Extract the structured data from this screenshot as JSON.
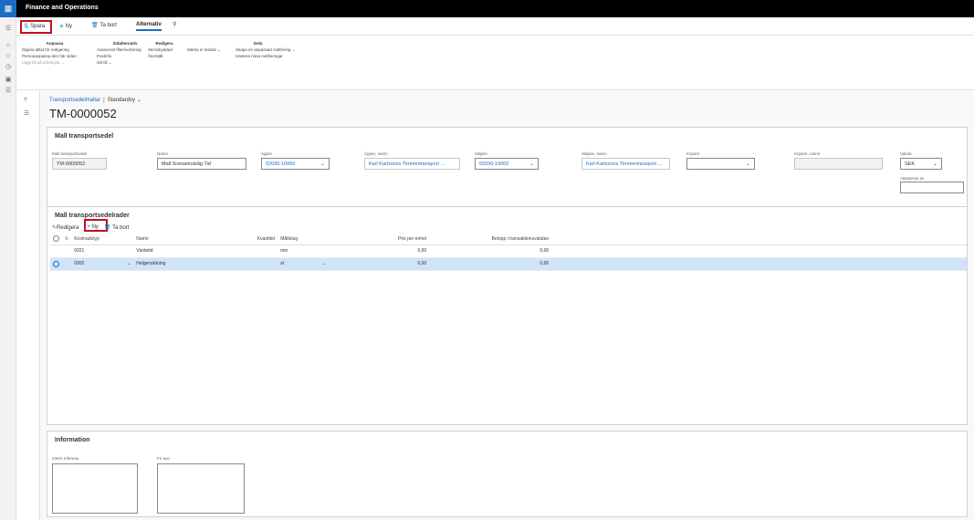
{
  "app": {
    "title": "Finance and Operations"
  },
  "cmdbar": {
    "save": "Spara",
    "new": "Ny",
    "delete": "Ta bort",
    "options": "Alternativ"
  },
  "ribbon": {
    "groups": [
      {
        "header": "Anpassa",
        "items": [
          "Öppna alltid för redigering",
          "Personanpassa den här sidan",
          "Lägg till på arbetsyta"
        ]
      },
      {
        "header": "Sidalternativ",
        "items": [
          "Avancerat filter/sortering",
          "Postinfo",
          "Gå till"
        ]
      },
      {
        "header": "Redigera",
        "items": [
          "Skrivskyddad",
          "Återställ"
        ]
      },
      {
        "header": "",
        "items": [
          "Märka er ändrat"
        ]
      },
      {
        "header": "Dela",
        "items": [
          "Skapa en anpassad notifiering",
          "Hantera mina notifieringar"
        ]
      }
    ]
  },
  "breadcrumb": {
    "link": "Transportsedelmallar",
    "view": "Standardvy"
  },
  "page": {
    "title": "TM-0000052"
  },
  "header_card": {
    "title": "Mall transportsedel",
    "fields": {
      "mall": {
        "label": "Mall transportsedel",
        "value": "TM-0000052"
      },
      "namn": {
        "label": "Namn",
        "value": "Mall Scenarioskåg Tid"
      },
      "agare": {
        "label": "Ägare",
        "value": "02030-10000"
      },
      "agare_namn": {
        "label": "Ägare, namn",
        "value": "Karl Karlssons Timmertransport ..."
      },
      "saljare": {
        "label": "Säljare",
        "value": "02030-10000"
      },
      "saljare_namn": {
        "label": "Säljare, namn",
        "value": "Karl Karlssons Timmertransport ..."
      },
      "kopare": {
        "label": "Köpare",
        "value": ""
      },
      "kopare_namn": {
        "label": "Köpare, namn",
        "value": ""
      },
      "valuta": {
        "label": "Valuta",
        "value": "SEK"
      },
      "attesteras": {
        "label": "Attesteras av",
        "value": ""
      }
    }
  },
  "lines_card": {
    "title": "Mall transportsedelrader",
    "toolbar": {
      "edit": "Redigera",
      "new": "Ny",
      "delete": "Ta bort"
    },
    "columns": {
      "kostnadstyp": "Kostnadstyp",
      "namn": "Namn",
      "kvantitet": "Kvantitet",
      "mattslag": "Måttslag",
      "pris": "Pris per enhet",
      "belopp": "Belopp i transaktionsvalutan"
    },
    "rows": [
      {
        "kostnadstyp": "0021",
        "namn": "Väntetid",
        "kvantitet": "",
        "mattslag": "min",
        "pris": "0,00",
        "belopp": "0,00"
      },
      {
        "kostnadstyp": "0002",
        "namn": "Helgersättning",
        "kvantitet": "",
        "mattslag": "st",
        "pris": "0,00",
        "belopp": "0,00"
      }
    ]
  },
  "info_card": {
    "title": "Information",
    "internal_ref": "Intern referens",
    "free_text": "Fri text"
  },
  "colors": {
    "accent": "#1b6ec2",
    "highlight": "#c50f1f",
    "selected_row": "#cfe4fa"
  }
}
